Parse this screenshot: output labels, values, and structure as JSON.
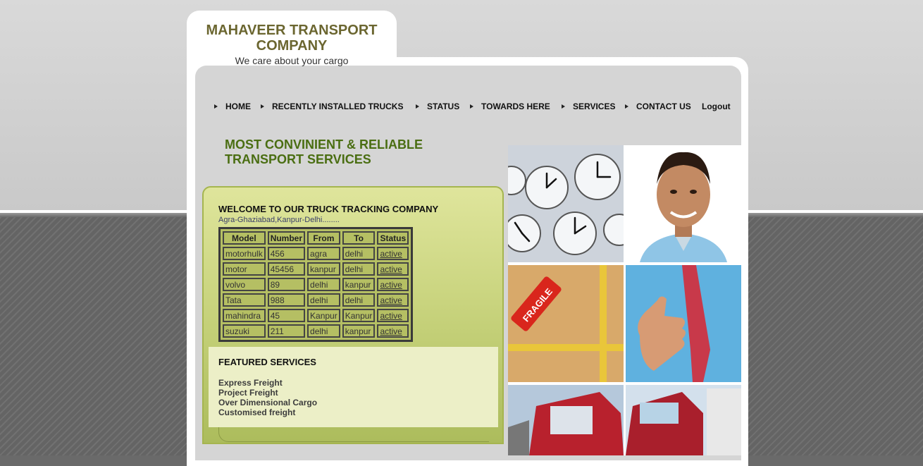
{
  "brand": {
    "title": "MAHAVEER TRANSPORT COMPANY",
    "tagline": "We care about your cargo"
  },
  "nav": {
    "items": [
      {
        "label": "HOME"
      },
      {
        "label": "RECENTLY INSTALLED TRUCKS"
      },
      {
        "label": "STATUS"
      },
      {
        "label": "TOWARDS HERE"
      },
      {
        "label": "SERVICES"
      },
      {
        "label": "CONTACT US"
      }
    ],
    "logout": "Logout"
  },
  "hero": {
    "title_line1": "MOST CONVINIENT & RELIABLE",
    "title_line2": "TRANSPORT SERVICES"
  },
  "welcome": {
    "title": "WELCOME TO OUR TRUCK TRACKING COMPANY",
    "route": "Agra-Ghaziabad,Kanpur-Delhi........"
  },
  "table": {
    "headers": [
      "Model",
      "Number",
      "From",
      "To",
      "Status"
    ],
    "rows": [
      [
        "motorhulk",
        "456",
        "agra",
        "delhi",
        "active"
      ],
      [
        "motor",
        "45456",
        "kanpur",
        "delhi",
        "active"
      ],
      [
        "volvo",
        "89",
        "delhi",
        "kanpur",
        "active"
      ],
      [
        "Tata",
        "988",
        "delhi",
        "delhi",
        "active"
      ],
      [
        "mahindra",
        "45",
        "Kanpur",
        "Kanpur",
        "active"
      ],
      [
        "suzuki",
        "211",
        "delhi",
        "kanpur",
        "active"
      ]
    ]
  },
  "featured": {
    "title": "FEATURED SERVICES",
    "items": [
      "Express Freight",
      "Project Freight",
      "Over Dimensional Cargo",
      "Customised freight"
    ]
  },
  "photos": {
    "fragile_label": "FRAGILE"
  },
  "colors": {
    "hero_green": "#4a6e12",
    "box_green": "#c9d47e",
    "brand_olive": "#6b6630"
  }
}
